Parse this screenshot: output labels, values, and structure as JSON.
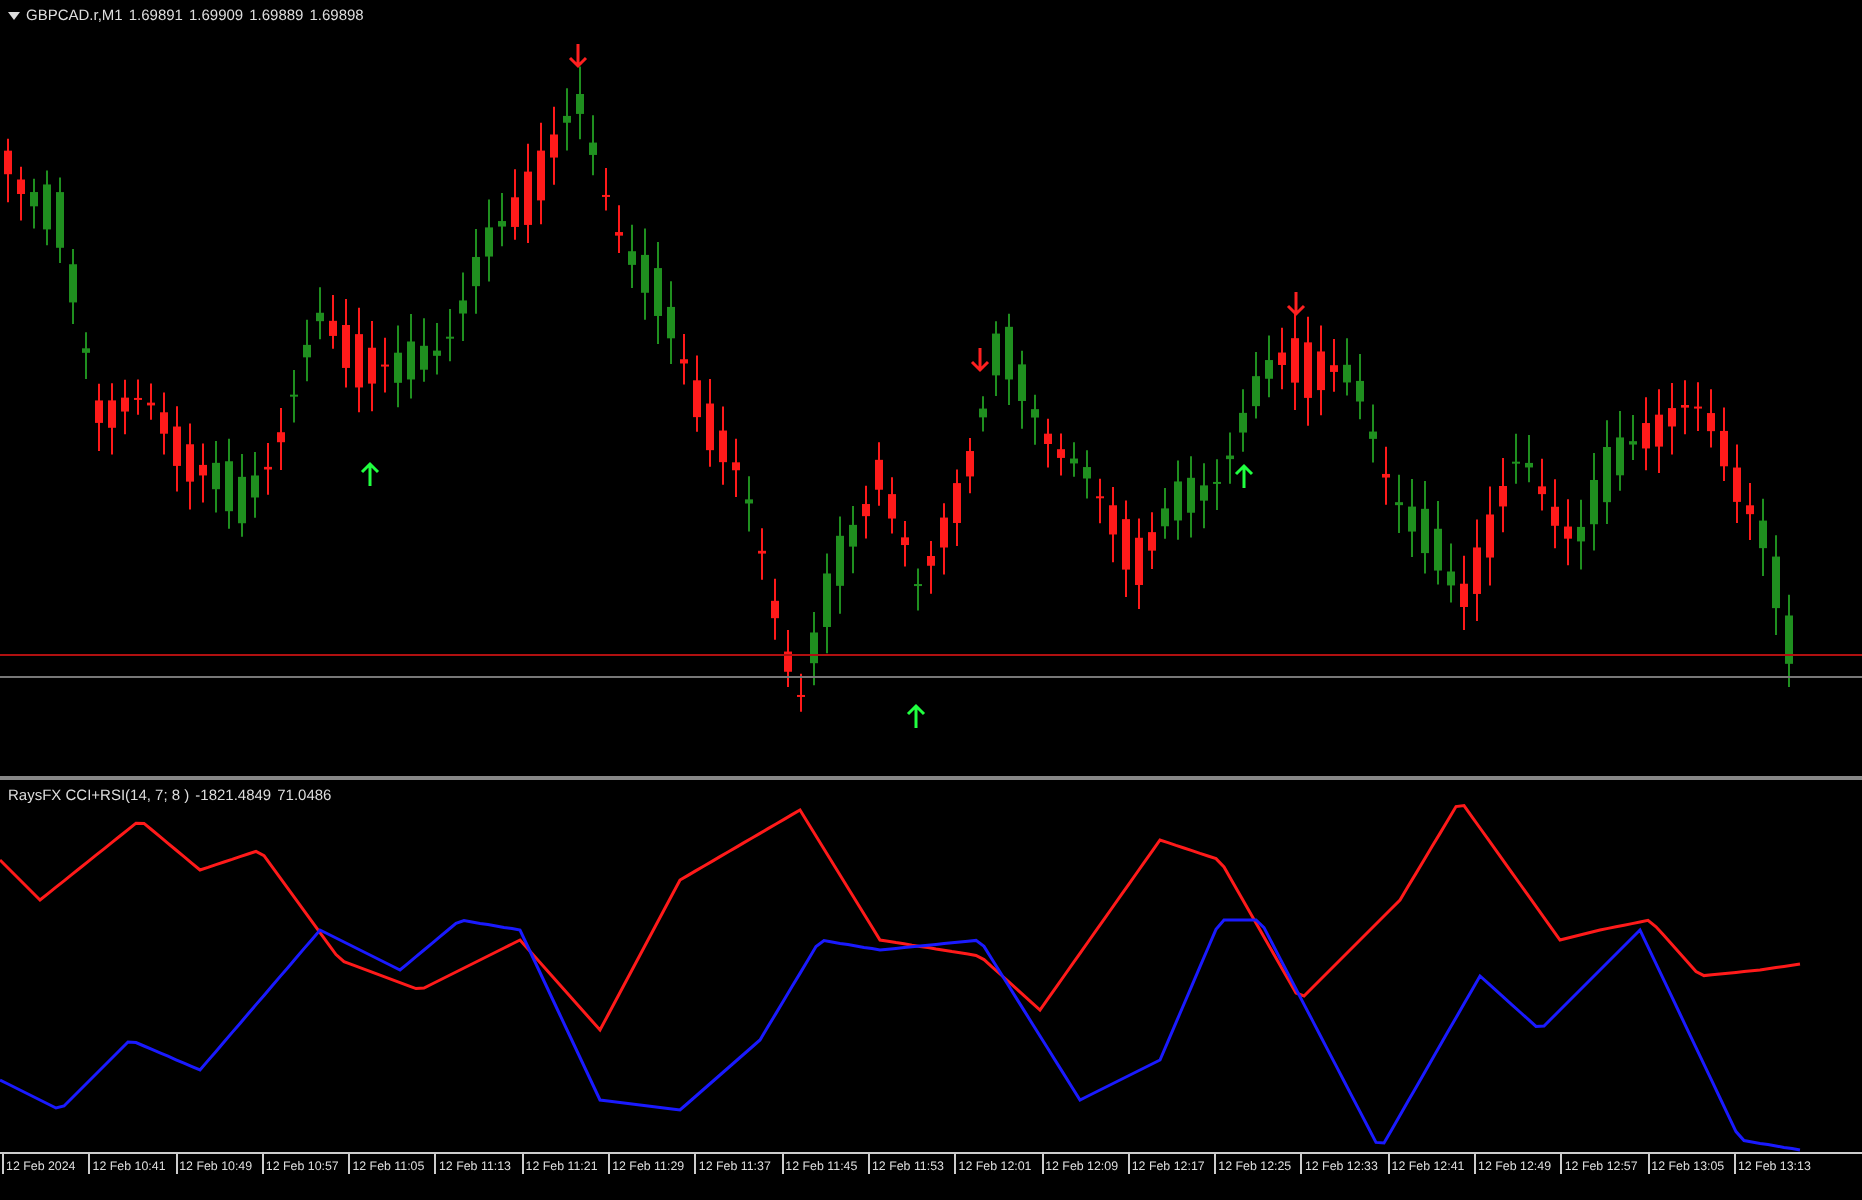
{
  "chart": {
    "symbol": "GBPCAD.r,M1",
    "quotes": [
      "1.69891",
      "1.69909",
      "1.69889",
      "1.69898"
    ]
  },
  "indicator": {
    "name": "RaysFX CCI+RSI(14, 7; 8 )",
    "values": [
      "-1821.4849",
      "71.0486"
    ]
  },
  "time_axis": [
    "12 Feb 2024",
    "12 Feb 10:41",
    "12 Feb 10:49",
    "12 Feb 10:57",
    "12 Feb 11:05",
    "12 Feb 11:13",
    "12 Feb 11:21",
    "12 Feb 11:29",
    "12 Feb 11:37",
    "12 Feb 11:45",
    "12 Feb 11:53",
    "12 Feb 12:01",
    "12 Feb 12:09",
    "12 Feb 12:17",
    "12 Feb 12:25",
    "12 Feb 12:33",
    "12 Feb 12:41",
    "12 Feb 12:49",
    "12 Feb 12:57",
    "12 Feb 13:05",
    "12 Feb 13:13"
  ]
}
